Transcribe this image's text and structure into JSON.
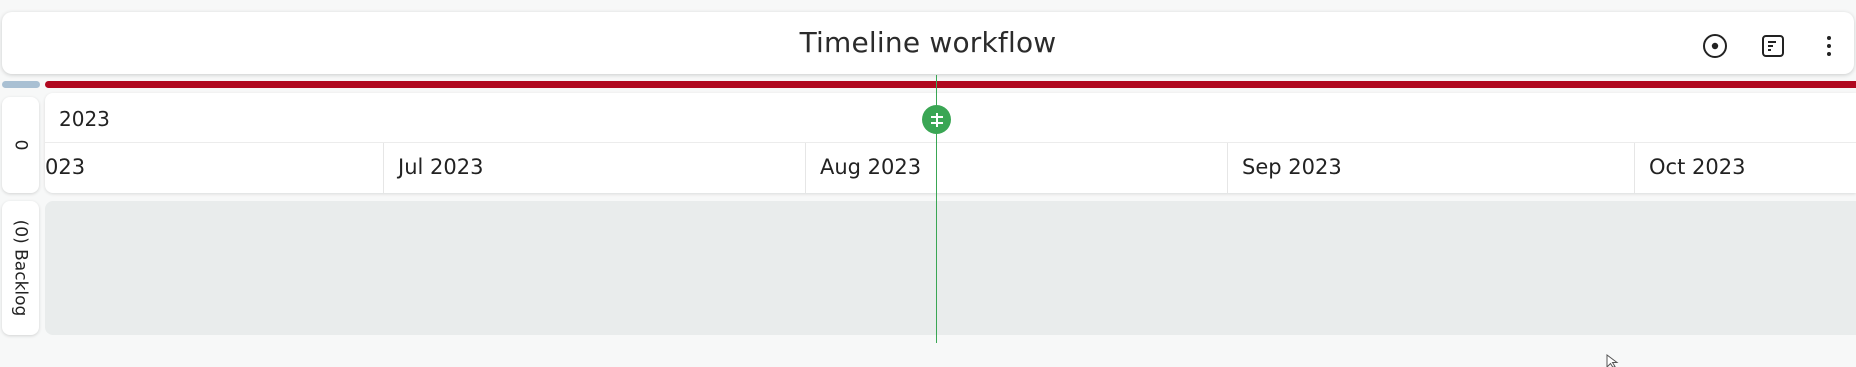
{
  "header": {
    "title": "Timeline workflow",
    "icons": [
      "target-icon",
      "notes-icon",
      "more-vertical-icon"
    ]
  },
  "colors": {
    "progress_main": "#b0081f",
    "progress_left": "#a9c0d3",
    "today": "#3aa654",
    "lane_background": "#e9ecec"
  },
  "lanes": [
    {
      "label": "0"
    },
    {
      "label": "(0) Backlog"
    }
  ],
  "timeline": {
    "year": "2023",
    "months": [
      "023",
      "Jul 2023",
      "Aug 2023",
      "Sep 2023",
      "Oct 2023"
    ]
  }
}
